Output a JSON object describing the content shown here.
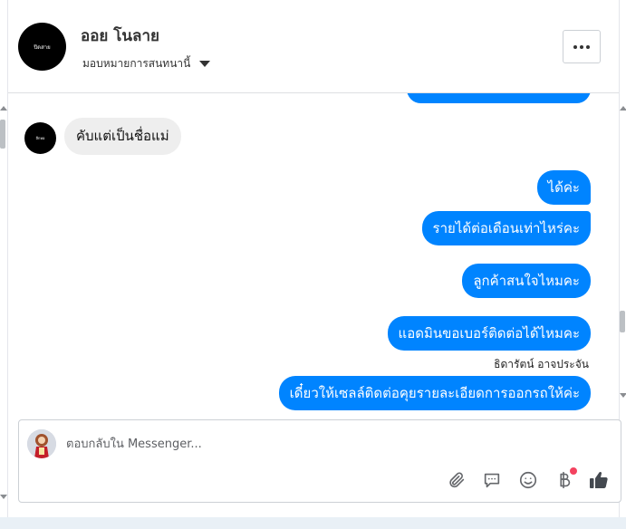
{
  "header": {
    "page_name": "ออย โนลาย",
    "assign_label": "มอบหมายการสนทนานี้",
    "avatar_text": "ปิดสาย"
  },
  "messages": {
    "incoming": {
      "text": "คับแต่เป็นชื่อแม่",
      "avatar_text": "ลีกหอ"
    },
    "outgoing": [
      {
        "text": "ได้ค่ะ"
      },
      {
        "text": "รายได้ต่อเดือนเท่าไหร่คะ"
      },
      {
        "text": "ลูกค้าสนใจไหมคะ"
      },
      {
        "text": "แอดมินขอเบอร์ติดต่อได้ไหมคะ"
      },
      {
        "text": "เดี๋ยวให้เซลล์ติดต่อคุยรายละเอียดการออกรถให้ค่ะ"
      }
    ],
    "sender_name": "ธิดารัตน์ อาจประจัน"
  },
  "composer": {
    "placeholder": "ตอบกลับใน Messenger..."
  },
  "icons": {
    "attach": "paperclip-icon",
    "saved_replies": "chat-bubble-icon",
    "emoji": "smiley-icon",
    "payment": "baht-icon",
    "like": "thumbs-up-icon"
  },
  "colors": {
    "accent": "#0084ff",
    "incoming_bubble": "#eeeeee",
    "notify": "#f3425f"
  }
}
